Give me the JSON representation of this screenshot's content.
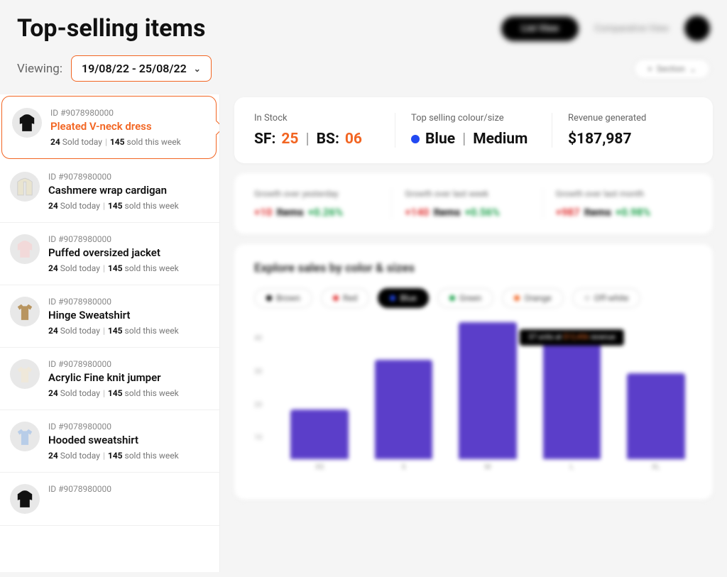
{
  "page_title": "Top-selling items",
  "viewing_label": "Viewing:",
  "date_range": "19/08/22 - 25/08/22",
  "header_buttons": {
    "primary": "List View",
    "secondary": "Comparative View"
  },
  "section_btn": "Section",
  "products": [
    {
      "id": "ID #9078980000",
      "name": "Pleated V-neck dress",
      "sold_today": "24",
      "sold_today_label": "Sold today",
      "sold_week": "145",
      "sold_week_label": "sold this week",
      "active": true,
      "thumb": "jacket-black"
    },
    {
      "id": "ID #9078980000",
      "name": "Cashmere wrap cardigan",
      "sold_today": "24",
      "sold_today_label": "Sold today",
      "sold_week": "145",
      "sold_week_label": "sold this week",
      "active": false,
      "thumb": "cardigan-cream"
    },
    {
      "id": "ID #9078980000",
      "name": "Puffed oversized jacket",
      "sold_today": "24",
      "sold_today_label": "Sold today",
      "sold_week": "145",
      "sold_week_label": "sold this week",
      "active": false,
      "thumb": "jacket-pink"
    },
    {
      "id": "ID #9078980000",
      "name": "Hinge Sweatshirt",
      "sold_today": "24",
      "sold_today_label": "Sold today",
      "sold_week": "145",
      "sold_week_label": "sold this week",
      "active": false,
      "thumb": "shirt-tan"
    },
    {
      "id": "ID #9078980000",
      "name": "Acrylic Fine knit jumper",
      "sold_today": "24",
      "sold_today_label": "Sold today",
      "sold_week": "145",
      "sold_week_label": "sold this week",
      "active": false,
      "thumb": "jumper-cream"
    },
    {
      "id": "ID #9078980000",
      "name": "Hooded sweatshirt",
      "sold_today": "24",
      "sold_today_label": "Sold today",
      "sold_week": "145",
      "sold_week_label": "sold this week",
      "active": false,
      "thumb": "shirt-blue"
    },
    {
      "id": "ID #9078980000",
      "name": "",
      "sold_today": "",
      "sold_today_label": "",
      "sold_week": "",
      "sold_week_label": "",
      "active": false,
      "thumb": "jacket-black"
    }
  ],
  "stats": {
    "stock_label": "In Stock",
    "sf_label": "SF:",
    "sf_value": "25",
    "bs_label": "BS:",
    "bs_value": "06",
    "top_combo_label": "Top selling colour/size",
    "top_color": "Blue",
    "top_size": "Medium",
    "revenue_label": "Revenue generated",
    "revenue_value": "$187,987"
  },
  "growth": [
    {
      "label": "Growth over yesterday",
      "value": "+10",
      "unit": "Items",
      "pct": "+0.26%"
    },
    {
      "label": "Growth over last week",
      "value": "+140",
      "unit": "Items",
      "pct": "+0.56%"
    },
    {
      "label": "Growth over last month",
      "value": "+987",
      "unit": "Items",
      "pct": "+0.98%"
    }
  ],
  "chart_section_title": "Explore sales by color & sizes",
  "color_filters": [
    {
      "name": "Brown",
      "color": "#000",
      "active": false
    },
    {
      "name": "Red",
      "color": "#e03030",
      "active": false
    },
    {
      "name": "Blue",
      "color": "#2249f2",
      "active": true
    },
    {
      "name": "Green",
      "color": "#18a048",
      "active": false
    },
    {
      "name": "Orange",
      "color": "#f26522",
      "active": false
    },
    {
      "name": "Off-white",
      "color": "#ddd",
      "active": false
    }
  ],
  "chart_tooltip": {
    "label": "37 units at",
    "value": "$12,456",
    "suffix": "revenue"
  },
  "chart_data": {
    "type": "bar",
    "categories": [
      "XS",
      "S",
      "M",
      "L",
      "XL"
    ],
    "values": [
      15,
      30,
      42,
      37,
      26
    ],
    "ylim": [
      0,
      45
    ],
    "y_ticks": [
      10,
      20,
      30,
      40
    ],
    "xlabel": "",
    "ylabel": "",
    "title": "Explore sales by color & sizes"
  }
}
